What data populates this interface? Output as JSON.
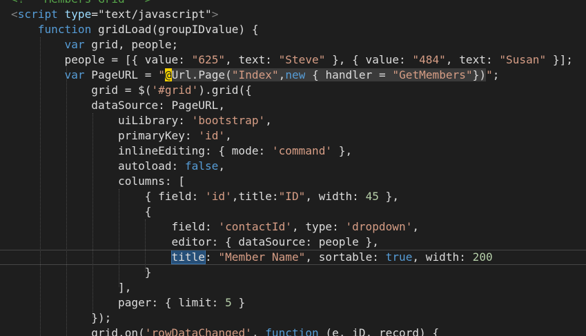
{
  "editor": {
    "lines": [
      [
        {
          "t": "<!-- Members Grid -->",
          "c": "t-com"
        }
      ],
      [
        {
          "t": "<",
          "c": "t-tag"
        },
        {
          "t": "script",
          "c": "t-tagname"
        },
        {
          "t": " ",
          "c": "t-plain"
        },
        {
          "t": "type",
          "c": "t-attr"
        },
        {
          "t": "=",
          "c": "t-plain"
        },
        {
          "t": "\"text/javascript\"",
          "c": "t-plain"
        },
        {
          "t": ">",
          "c": "t-tag"
        }
      ],
      [
        {
          "t": "    ",
          "c": "t-plain"
        },
        {
          "t": "function",
          "c": "t-kw"
        },
        {
          "t": " gridLoad(groupIDvalue) {",
          "c": "t-plain"
        }
      ],
      [
        {
          "t": "        ",
          "c": "t-plain"
        },
        {
          "t": "var",
          "c": "t-kw"
        },
        {
          "t": " grid, people;",
          "c": "t-plain"
        }
      ],
      [
        {
          "t": "        people = [{ value: ",
          "c": "t-plain"
        },
        {
          "t": "\"625\"",
          "c": "t-str"
        },
        {
          "t": ", text: ",
          "c": "t-plain"
        },
        {
          "t": "\"Steve\"",
          "c": "t-str"
        },
        {
          "t": " }, { value: ",
          "c": "t-plain"
        },
        {
          "t": "\"484\"",
          "c": "t-str"
        },
        {
          "t": ", text: ",
          "c": "t-plain"
        },
        {
          "t": "\"Susan\"",
          "c": "t-str"
        },
        {
          "t": " }];",
          "c": "t-plain"
        }
      ],
      [
        {
          "t": "        ",
          "c": "t-plain"
        },
        {
          "t": "var",
          "c": "t-kw"
        },
        {
          "t": " PageURL = ",
          "c": "t-plain"
        },
        {
          "t": "\"",
          "c": "t-str"
        },
        {
          "t": "@",
          "c": "t-razor"
        },
        {
          "t": "Url.Page(",
          "c": "t-plain razor-block"
        },
        {
          "t": "\"Index\"",
          "c": "t-str razor-block"
        },
        {
          "t": ",",
          "c": "t-plain razor-block"
        },
        {
          "t": "new",
          "c": "t-kw razor-block"
        },
        {
          "t": " { handler = ",
          "c": "t-plain razor-block"
        },
        {
          "t": "\"GetMembers\"",
          "c": "t-str razor-block"
        },
        {
          "t": "})",
          "c": "t-plain razor-block"
        },
        {
          "t": "\"",
          "c": "t-str"
        },
        {
          "t": ";",
          "c": "t-plain"
        }
      ],
      [
        {
          "t": "            grid = $(",
          "c": "t-plain"
        },
        {
          "t": "'#grid'",
          "c": "t-str"
        },
        {
          "t": ").grid({",
          "c": "t-plain"
        }
      ],
      [
        {
          "t": "            dataSource: PageURL,",
          "c": "t-plain"
        }
      ],
      [
        {
          "t": "                uiLibrary: ",
          "c": "t-plain"
        },
        {
          "t": "'bootstrap'",
          "c": "t-str"
        },
        {
          "t": ",",
          "c": "t-plain"
        }
      ],
      [
        {
          "t": "                primaryKey: ",
          "c": "t-plain"
        },
        {
          "t": "'id'",
          "c": "t-str"
        },
        {
          "t": ",",
          "c": "t-plain"
        }
      ],
      [
        {
          "t": "                inlineEditing: { mode: ",
          "c": "t-plain"
        },
        {
          "t": "'command'",
          "c": "t-str"
        },
        {
          "t": " },",
          "c": "t-plain"
        }
      ],
      [
        {
          "t": "                autoload: ",
          "c": "t-plain"
        },
        {
          "t": "false",
          "c": "t-kw"
        },
        {
          "t": ",",
          "c": "t-plain"
        }
      ],
      [
        {
          "t": "                columns: [",
          "c": "t-plain"
        }
      ],
      [
        {
          "t": "                    { field: ",
          "c": "t-plain"
        },
        {
          "t": "'id'",
          "c": "t-str"
        },
        {
          "t": ",title:",
          "c": "t-plain"
        },
        {
          "t": "\"ID\"",
          "c": "t-str"
        },
        {
          "t": ", width: ",
          "c": "t-plain"
        },
        {
          "t": "45",
          "c": "t-num"
        },
        {
          "t": " },",
          "c": "t-plain"
        }
      ],
      [
        {
          "t": "                    {",
          "c": "t-plain"
        }
      ],
      [
        {
          "t": "                        field: ",
          "c": "t-plain"
        },
        {
          "t": "'contactId'",
          "c": "t-str"
        },
        {
          "t": ", type: ",
          "c": "t-plain"
        },
        {
          "t": "'dropdown'",
          "c": "t-str"
        },
        {
          "t": ",",
          "c": "t-plain"
        }
      ],
      [
        {
          "t": "                        editor: { dataSource: people },",
          "c": "t-plain"
        }
      ],
      [
        {
          "t": "                        ",
          "c": "t-plain"
        },
        {
          "t": "title",
          "c": "t-plain sel"
        },
        {
          "t": ": ",
          "c": "t-plain"
        },
        {
          "t": "\"Member Name\"",
          "c": "t-str"
        },
        {
          "t": ", sortable: ",
          "c": "t-plain"
        },
        {
          "t": "true",
          "c": "t-kw"
        },
        {
          "t": ", width: ",
          "c": "t-plain"
        },
        {
          "t": "200",
          "c": "t-num"
        }
      ],
      [
        {
          "t": "                    }",
          "c": "t-plain"
        }
      ],
      [
        {
          "t": "                ],",
          "c": "t-plain"
        }
      ],
      [
        {
          "t": "                pager: { limit: ",
          "c": "t-plain"
        },
        {
          "t": "5",
          "c": "t-num"
        },
        {
          "t": " }",
          "c": "t-plain"
        }
      ],
      [
        {
          "t": "            });",
          "c": "t-plain"
        }
      ],
      [
        {
          "t": "            grid.on(",
          "c": "t-plain"
        },
        {
          "t": "'rowDataChanged'",
          "c": "t-str"
        },
        {
          "t": ", ",
          "c": "t-plain"
        },
        {
          "t": "function",
          "c": "t-kw"
        },
        {
          "t": " (e, iD, record) {",
          "c": "t-plain"
        }
      ]
    ]
  }
}
